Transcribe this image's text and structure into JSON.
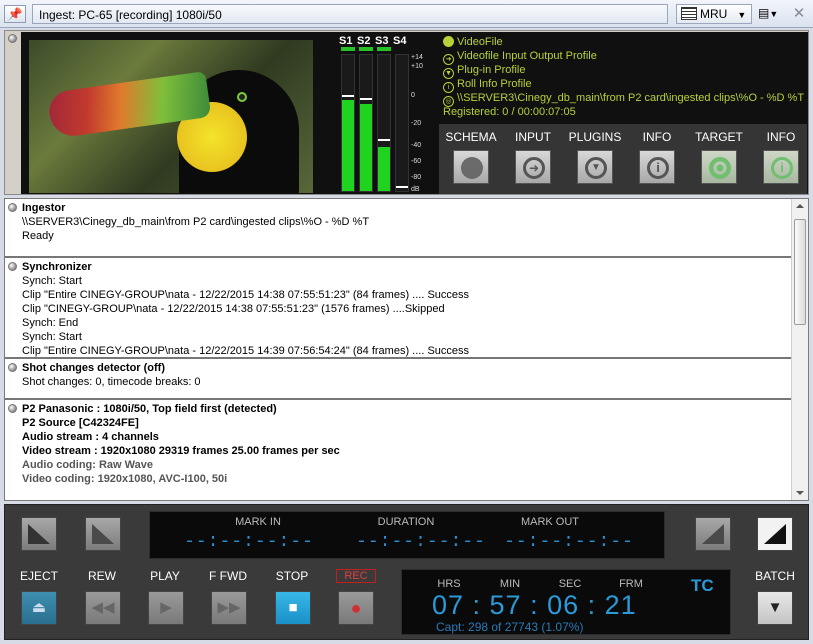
{
  "window": {
    "pin_icon": "pin-icon",
    "title": "Ingest: PC-65 [recording] 1080i/50",
    "mru_label": "MRU",
    "close_glyph": "✕"
  },
  "meters": {
    "channels": [
      "S1",
      "S2",
      "S3",
      "S4"
    ],
    "scale": [
      "+14",
      "+10",
      "0",
      "-20",
      "-40",
      "-60",
      "-80",
      "dB"
    ],
    "levels": [
      0.66,
      0.63,
      0.32,
      0.0
    ],
    "peaks": [
      0.68,
      0.66,
      0.36,
      0.02
    ]
  },
  "info": {
    "lines": [
      {
        "icon": "solid-circle-icon",
        "text": "VideoFile"
      },
      {
        "icon": "input-arrow-icon",
        "text": "Videofile Input Output Profile"
      },
      {
        "icon": "plugin-down-icon",
        "text": "Plug-in Profile"
      },
      {
        "icon": "info-icon",
        "text": "Roll Info Profile"
      },
      {
        "icon": "target-icon",
        "text": "\\\\SERVER3\\Cinegy_db_main\\from P2 card\\ingested clips\\%O - %D %T"
      }
    ],
    "registered": "Registered: 0 / 00:00:07:05"
  },
  "functions": [
    {
      "label": "SCHEMA",
      "icon": "circle-icon"
    },
    {
      "label": "INPUT",
      "icon": "input-arrow-icon"
    },
    {
      "label": "PLUGINS",
      "icon": "down-arrow-icon"
    },
    {
      "label": "INFO",
      "icon": "info-icon"
    },
    {
      "label": "TARGET",
      "icon": "target-icon"
    },
    {
      "label": "INFO",
      "icon": "info-icon"
    }
  ],
  "log": {
    "ingestor": [
      "Ingestor",
      "\\\\SERVER3\\Cinegy_db_main\\from P2 card\\ingested clips\\%O - %D %T",
      "Ready"
    ],
    "synchronizer": [
      "Synchronizer",
      "Synch: Start",
      "Clip \"Entire CINEGY-GROUP\\nata - 12/22/2015 14:38 07:55:51:23\" (84 frames) .... Success",
      "Clip \"CINEGY-GROUP\\nata - 12/22/2015 14:38 07:55:51:23\" (1576 frames) ....Skipped",
      "Synch: End",
      "Synch: Start",
      "Clip \"Entire CINEGY-GROUP\\nata - 12/22/2015 14:39 07:56:54:24\" (84 frames) .... Success"
    ],
    "shot": [
      "Shot changes detector (off)",
      "Shot changes: 0, timecode breaks: 0"
    ],
    "p2": [
      "P2 Panasonic : 1080i/50, Top field first (detected)",
      "P2 Source [C42324FE]",
      "Audio stream : 4 channels",
      "Video stream : 1920x1080  29319 frames  25.00 frames per sec",
      "Audio coding: Raw Wave",
      "Video coding: 1920x1080, AVC-I100, 50i"
    ]
  },
  "marks": {
    "mark_in_label": "MARK IN",
    "duration_label": "DURATION",
    "mark_out_label": "MARK OUT",
    "mark_in": "--:--:--:--",
    "duration": "--:--:--:--",
    "mark_out": "--:--:--:--"
  },
  "transport": {
    "eject": "EJECT",
    "rew": "REW",
    "play": "PLAY",
    "ffwd": "F FWD",
    "stop": "STOP",
    "rec": "REC",
    "batch": "BATCH"
  },
  "timecode": {
    "hrs_label": "HRS",
    "min_label": "MIN",
    "sec_label": "SEC",
    "frm_label": "FRM",
    "tag": "TC",
    "value": "07 : 57 : 06 : 21",
    "capture": "Capt: 298 of 27743 (1.07%)"
  }
}
